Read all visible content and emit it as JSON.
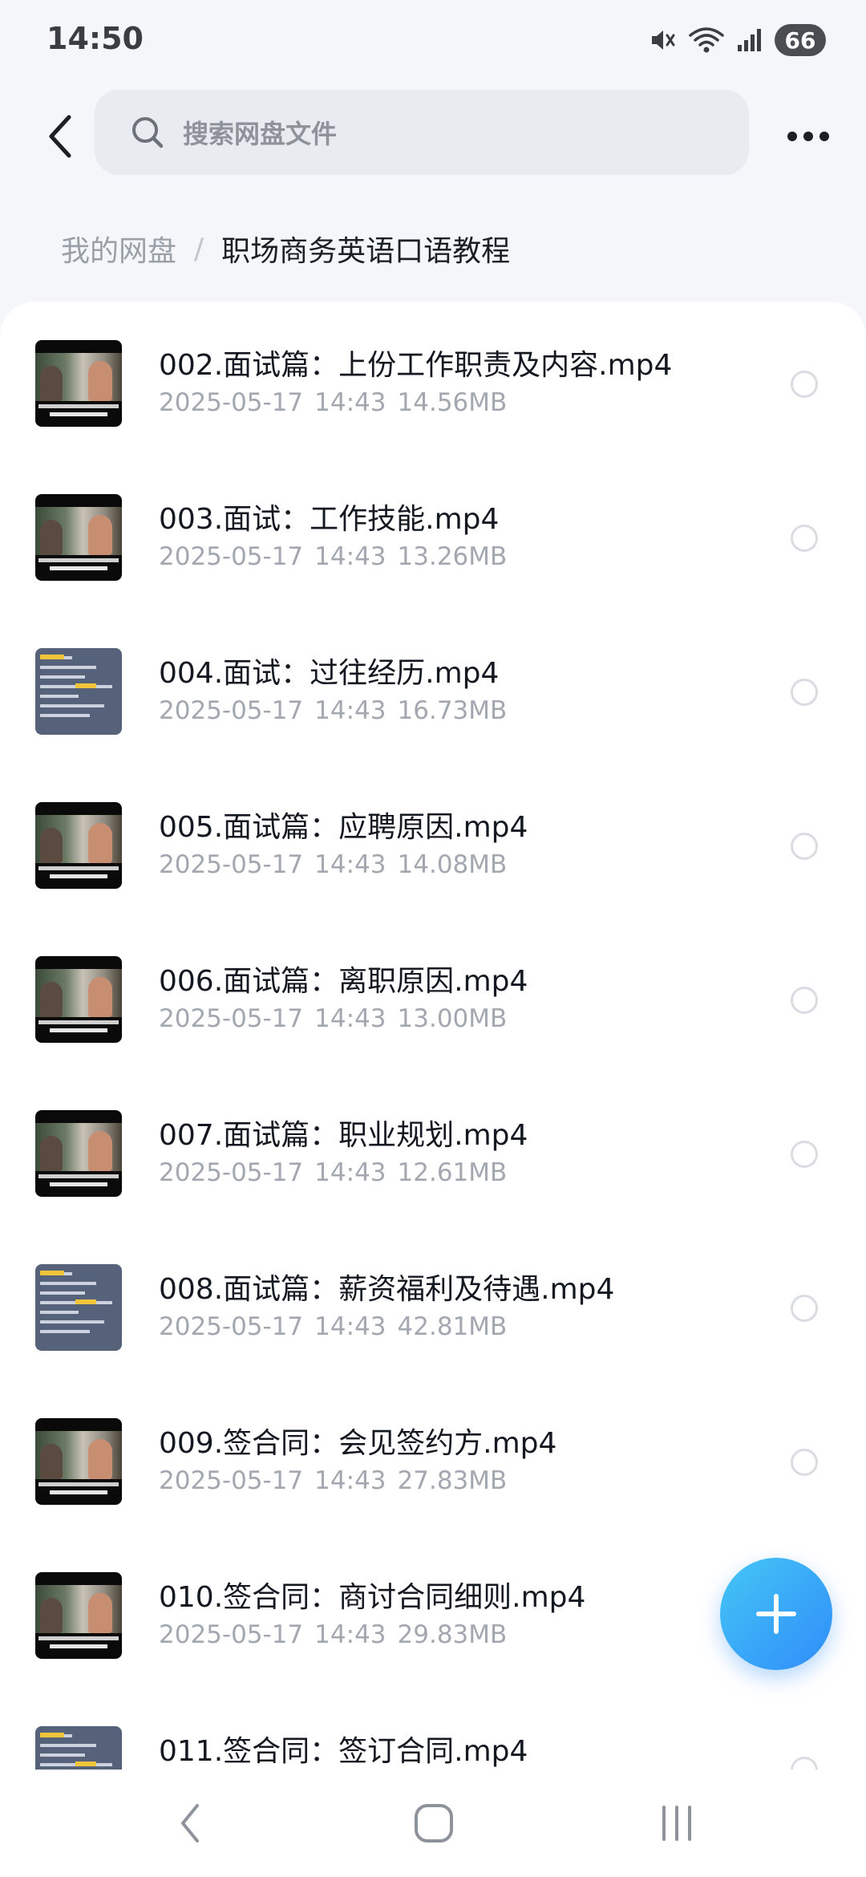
{
  "status_bar": {
    "time": "14:50",
    "battery": "66",
    "icons": [
      "mute-icon",
      "wifi-icon",
      "signal-icon",
      "battery-icon"
    ]
  },
  "header": {
    "search_placeholder": "搜索网盘文件"
  },
  "breadcrumb": {
    "root": "我的网盘",
    "separator": "/",
    "current": "职场商务英语口语教程"
  },
  "files": [
    {
      "name": "002.面试篇：上份工作职责及内容.mp4",
      "date": "2025-05-17",
      "time": "14:43",
      "size": "14.56MB",
      "thumb": "video"
    },
    {
      "name": "003.面试：工作技能.mp4",
      "date": "2025-05-17",
      "time": "14:43",
      "size": "13.26MB",
      "thumb": "video"
    },
    {
      "name": "004.面试：过往经历.mp4",
      "date": "2025-05-17",
      "time": "14:43",
      "size": "16.73MB",
      "thumb": "slide"
    },
    {
      "name": "005.面试篇：应聘原因.mp4",
      "date": "2025-05-17",
      "time": "14:43",
      "size": "14.08MB",
      "thumb": "video"
    },
    {
      "name": "006.面试篇：离职原因.mp4",
      "date": "2025-05-17",
      "time": "14:43",
      "size": "13.00MB",
      "thumb": "video"
    },
    {
      "name": "007.面试篇：职业规划.mp4",
      "date": "2025-05-17",
      "time": "14:43",
      "size": "12.61MB",
      "thumb": "video"
    },
    {
      "name": "008.面试篇：薪资福利及待遇.mp4",
      "date": "2025-05-17",
      "time": "14:43",
      "size": "42.81MB",
      "thumb": "slide"
    },
    {
      "name": "009.签合同：会见签约方.mp4",
      "date": "2025-05-17",
      "time": "14:43",
      "size": "27.83MB",
      "thumb": "video"
    },
    {
      "name": "010.签合同：商讨合同细则.mp4",
      "date": "2025-05-17",
      "time": "14:43",
      "size": "29.83MB",
      "thumb": "video"
    },
    {
      "name": "011.签合同：签订合同.mp4",
      "date": "",
      "time": "",
      "size": "",
      "thumb": "slide"
    }
  ],
  "colors": {
    "accent": "#2f8dfa",
    "fab_gradient_start": "#45c6f5",
    "meta_text": "#a3a8b0"
  }
}
